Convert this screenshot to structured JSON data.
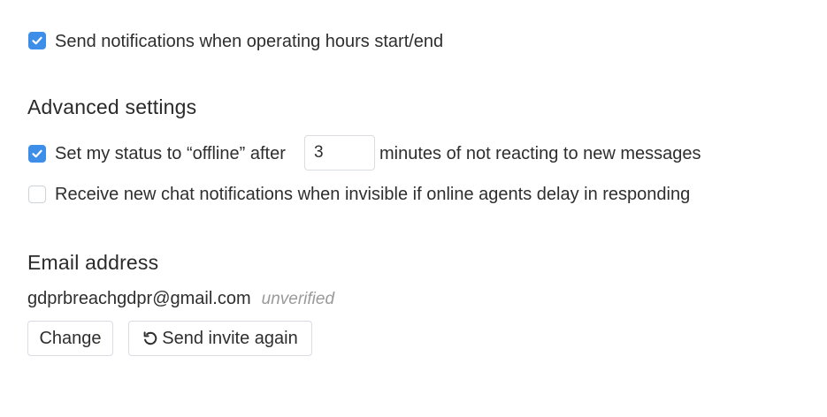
{
  "notifications": {
    "hours_checkbox_checked": true,
    "hours_label": "Send notifications when operating hours start/end"
  },
  "advanced": {
    "heading": "Advanced settings",
    "offline": {
      "checked": true,
      "label_before": "Set my status to “offline” after",
      "minutes_value": "3",
      "label_after": "minutes of not reacting to new messages"
    },
    "invisible": {
      "checked": false,
      "label": "Receive new chat notifications when invisible if online agents delay in responding"
    }
  },
  "email": {
    "heading": "Email address",
    "address": "gdprbreachgdpr@gmail.com",
    "status": "unverified",
    "change_label": "Change",
    "resend_label": "Send invite again",
    "resend_icon": "refresh-icon"
  },
  "colors": {
    "accent": "#3d8ee8"
  }
}
